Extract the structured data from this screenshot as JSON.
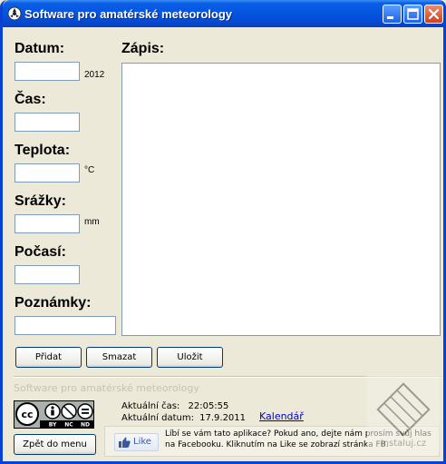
{
  "window": {
    "title": "Software pro amatérské meteorology"
  },
  "fields": {
    "datum": {
      "label": "Datum:",
      "value": "",
      "unit": "2012"
    },
    "cas": {
      "label": "Čas:",
      "value": ""
    },
    "teplota": {
      "label": "Teplota:",
      "value": "",
      "unit": "°C"
    },
    "srazky": {
      "label": "Srážky:",
      "value": "",
      "unit": "mm"
    },
    "pocasi": {
      "label": "Počasí:",
      "value": ""
    },
    "poznamky": {
      "label": "Poznámky:",
      "value": ""
    }
  },
  "zapis": {
    "label": "Zápis:",
    "value": ""
  },
  "buttons": {
    "pridat": "Přidat",
    "smazat": "Smazat",
    "ulozit": "Uložit",
    "zpet": "Zpět do menu"
  },
  "footer": {
    "app_name": "Software pro amatérské meteorology",
    "license_logo": {
      "main": "cc",
      "badges": [
        "BY",
        "NC",
        "ND"
      ]
    },
    "time_label": "Aktuální čas:",
    "time_value": "22:05:55",
    "date_label": "Aktuální datum:",
    "date_value": "17.9.2011",
    "calendar_link": "Kalendář"
  },
  "facebook": {
    "like_label": "Like",
    "text": "Líbí se vám tato aplikace? Pokud ano, dejte nám prosím svůj hlas na Facebooku. Kliknutím na Like se zobrazí stránka FB."
  },
  "watermark": {
    "text": "instaluj.cz"
  },
  "colors": {
    "titlebar": "#0554e0",
    "window_bg": "#ece9d8",
    "link": "#0000cc",
    "input_border": "#7f9db9"
  },
  "icons": {
    "app": "weather-app-icon",
    "minimize": "minimize-icon",
    "maximize": "maximize-icon",
    "close": "close-icon",
    "like": "thumbs-up-icon"
  }
}
